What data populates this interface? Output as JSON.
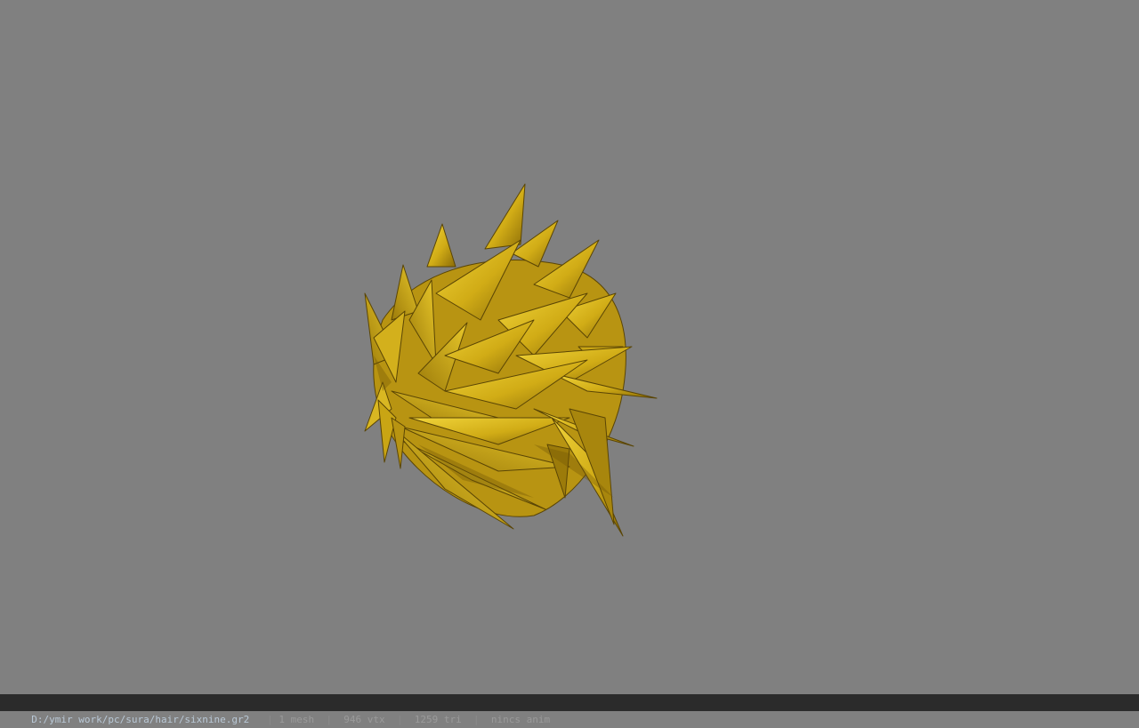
{
  "viewport": {
    "background_color": "#808080",
    "model": {
      "icon": "spiky-hair-mesh",
      "colors": {
        "light": "#e8c92a",
        "mid": "#c9a514",
        "dark": "#7a5e06",
        "edge": "#4f3c05"
      }
    }
  },
  "status_bar": {
    "file_path": "D:/ymir work/pc/sura/hair/sixnine.gr2",
    "separator": "|",
    "mesh_count": "1 mesh",
    "vertex_count": "946 vtx",
    "triangle_count": "1259 tri",
    "anim_status": "nincs anim"
  }
}
